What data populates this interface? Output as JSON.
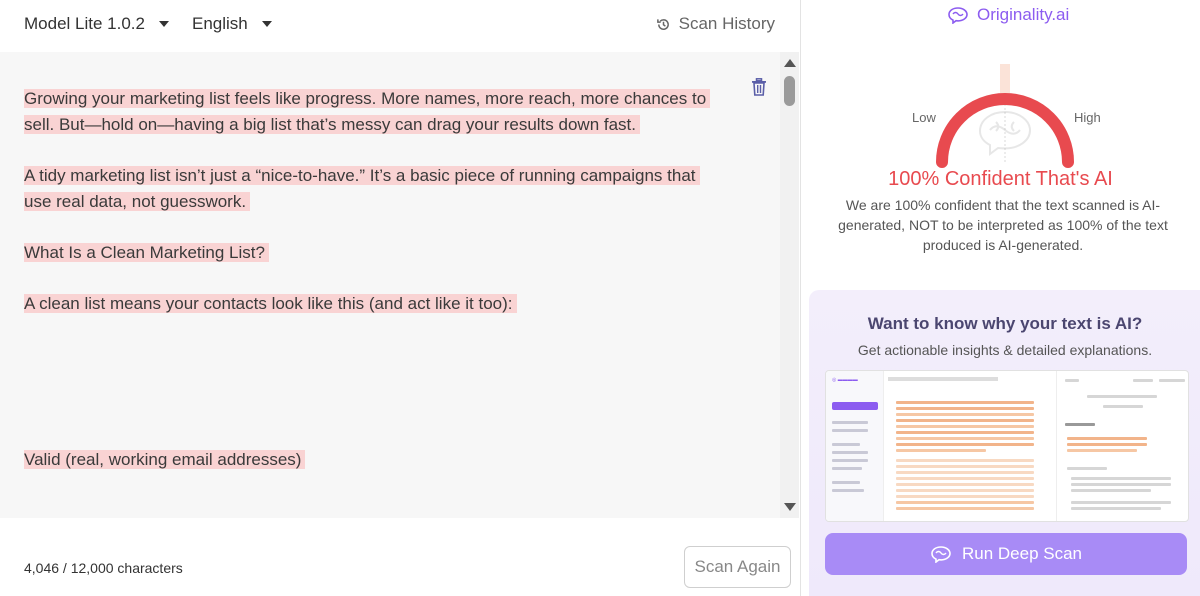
{
  "topbar": {
    "model": "Model Lite 1.0.2",
    "language": "English",
    "history": "Scan History"
  },
  "editor": {
    "paragraphs": [
      "Growing your marketing list feels like progress. More names, more reach, more chances to sell. But—hold on—having a big list that’s messy can drag your results down fast.",
      "A tidy marketing list isn’t just a “nice-to-have.” It’s a basic piece of running campaigns that use real data, not guesswork.",
      "What Is a Clean Marketing List?",
      "A clean list means your contacts look like this (and act like it too):",
      "Valid (real, working email addresses)"
    ]
  },
  "footer": {
    "char_count": "4,046 / 12,000 characters",
    "scan_again": "Scan Again"
  },
  "result": {
    "brand": "Originality.ai",
    "low": "Low",
    "high": "High",
    "score_fraction": 1.0,
    "headline": "100% Confident That's AI",
    "description": "We are 100% confident that the text scanned is AI-generated, NOT to be interpreted as 100% of the text produced is AI-generated.",
    "accent_color": "#e84a4f"
  },
  "promo": {
    "title": "Want to know why your text is AI?",
    "subtitle": "Get actionable insights & detailed explanations.",
    "button": "Run Deep Scan",
    "button_color": "#a88bf6"
  }
}
